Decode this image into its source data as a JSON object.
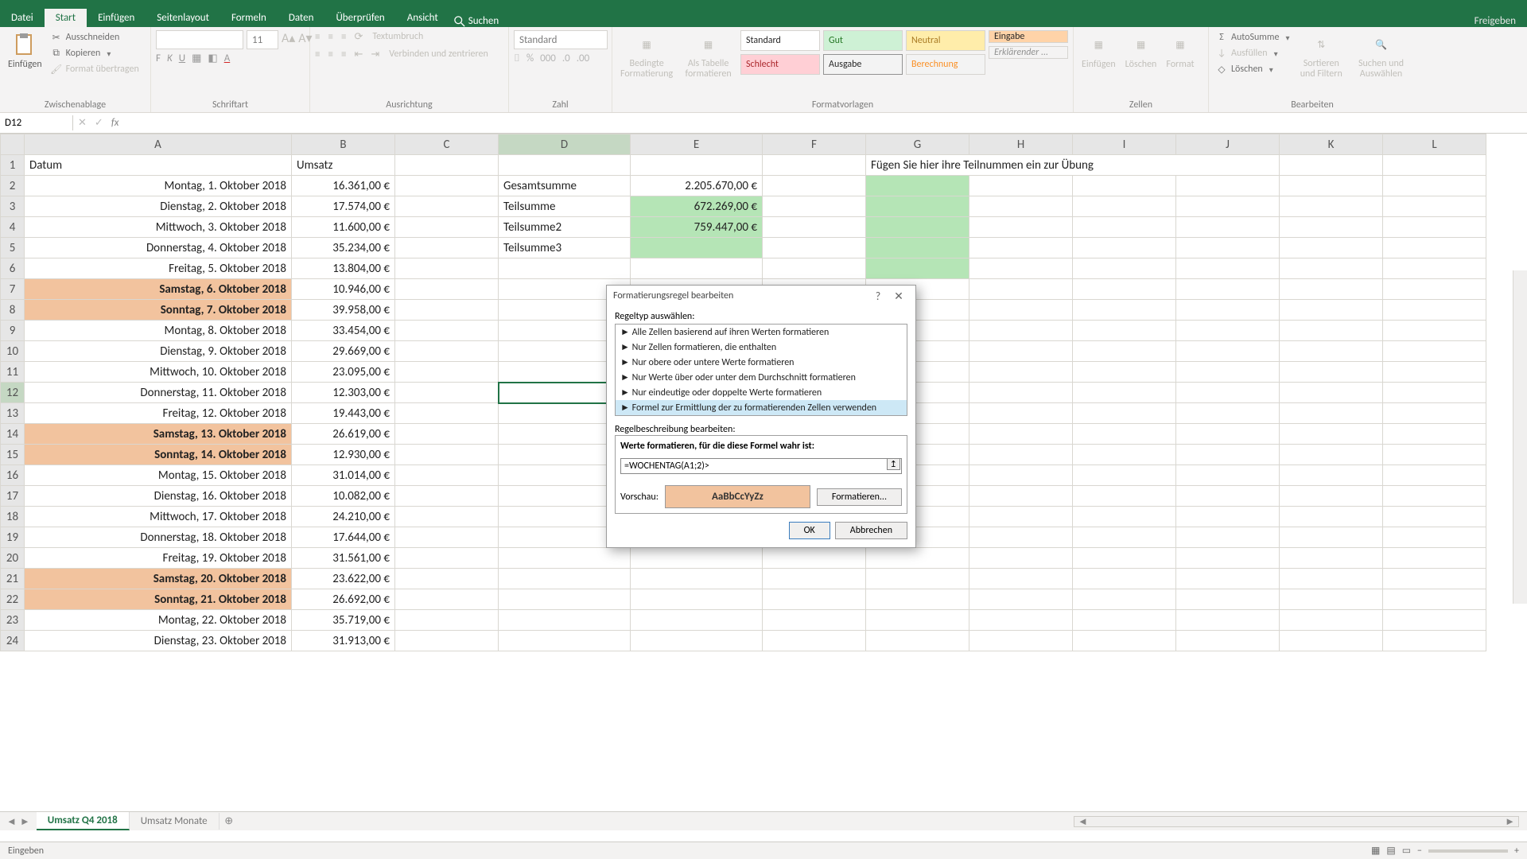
{
  "tabs": {
    "datei": "Datei",
    "start": "Start",
    "einfuegen": "Einfügen",
    "seitenlayout": "Seitenlayout",
    "formeln": "Formeln",
    "daten": "Daten",
    "ueberpruefen": "Überprüfen",
    "ansicht": "Ansicht",
    "suchen": "Suchen"
  },
  "share": "Freigeben",
  "ribbon": {
    "clipboard": {
      "label": "Zwischenablage",
      "paste": "Einfügen",
      "cut": "Ausschneiden",
      "copy": "Kopieren",
      "format": "Format übertragen"
    },
    "font": {
      "label": "Schriftart",
      "font_name": "",
      "size": "11"
    },
    "align": {
      "label": "Ausrichtung",
      "wrap": "Textumbruch",
      "merge": "Verbinden und zentrieren"
    },
    "number": {
      "label": "Zahl",
      "format": "Standard"
    },
    "styles": {
      "label": "Formatvorlagen",
      "cond": "Bedingte Formatierung",
      "table": "Als Tabelle formatieren",
      "s1": "Standard",
      "s2": "Gut",
      "s3": "Neutral",
      "s4": "Schlecht",
      "s5": "Ausgabe",
      "s6": "Berechnung",
      "s7": "Eingabe",
      "s8": "Erklärender ..."
    },
    "cells": {
      "label": "Zellen",
      "insert": "Einfügen",
      "delete": "Löschen",
      "format": "Format"
    },
    "editing": {
      "label": "Bearbeiten",
      "sum": "AutoSumme",
      "fill": "Ausfüllen",
      "clear": "Löschen",
      "sort": "Sortieren und Filtern",
      "find": "Suchen und Auswählen"
    }
  },
  "namebox": "D12",
  "columns": [
    "A",
    "B",
    "C",
    "D",
    "E",
    "F",
    "G",
    "H",
    "I",
    "J",
    "K",
    "L"
  ],
  "header_row": {
    "A": "Datum",
    "B": "Umsatz",
    "G": "Fügen Sie hier ihre Teilnummen ein zur Übung"
  },
  "summary": {
    "d2": "Gesamtsumme",
    "e2": "2.205.670,00 €",
    "d3": "Teilsumme",
    "e3": "672.269,00 €",
    "d4": "Teilsumme2",
    "e4": "759.447,00 €",
    "d5": "Teilsumme3"
  },
  "rows": [
    {
      "r": 2,
      "a": "Montag, 1. Oktober 2018",
      "b": "16.361,00 €"
    },
    {
      "r": 3,
      "a": "Dienstag, 2. Oktober 2018",
      "b": "17.574,00 €"
    },
    {
      "r": 4,
      "a": "Mittwoch, 3. Oktober 2018",
      "b": "11.600,00 €"
    },
    {
      "r": 5,
      "a": "Donnerstag, 4. Oktober 2018",
      "b": "35.234,00 €"
    },
    {
      "r": 6,
      "a": "Freitag, 5. Oktober 2018",
      "b": "13.804,00 €"
    },
    {
      "r": 7,
      "a": "Samstag, 6. Oktober 2018",
      "b": "10.946,00 €",
      "w": true
    },
    {
      "r": 8,
      "a": "Sonntag, 7. Oktober 2018",
      "b": "39.958,00 €",
      "w": true
    },
    {
      "r": 9,
      "a": "Montag, 8. Oktober 2018",
      "b": "33.454,00 €"
    },
    {
      "r": 10,
      "a": "Dienstag, 9. Oktober 2018",
      "b": "29.669,00 €"
    },
    {
      "r": 11,
      "a": "Mittwoch, 10. Oktober 2018",
      "b": "23.095,00 €"
    },
    {
      "r": 12,
      "a": "Donnerstag, 11. Oktober 2018",
      "b": "12.303,00 €"
    },
    {
      "r": 13,
      "a": "Freitag, 12. Oktober 2018",
      "b": "19.443,00 €"
    },
    {
      "r": 14,
      "a": "Samstag, 13. Oktober 2018",
      "b": "26.619,00 €",
      "w": true
    },
    {
      "r": 15,
      "a": "Sonntag, 14. Oktober 2018",
      "b": "12.930,00 €",
      "w": true
    },
    {
      "r": 16,
      "a": "Montag, 15. Oktober 2018",
      "b": "31.014,00 €"
    },
    {
      "r": 17,
      "a": "Dienstag, 16. Oktober 2018",
      "b": "10.082,00 €"
    },
    {
      "r": 18,
      "a": "Mittwoch, 17. Oktober 2018",
      "b": "24.210,00 €"
    },
    {
      "r": 19,
      "a": "Donnerstag, 18. Oktober 2018",
      "b": "17.644,00 €"
    },
    {
      "r": 20,
      "a": "Freitag, 19. Oktober 2018",
      "b": "31.561,00 €"
    },
    {
      "r": 21,
      "a": "Samstag, 20. Oktober 2018",
      "b": "23.622,00 €",
      "w": true
    },
    {
      "r": 22,
      "a": "Sonntag, 21. Oktober 2018",
      "b": "26.692,00 €",
      "w": true
    },
    {
      "r": 23,
      "a": "Montag, 22. Oktober 2018",
      "b": "35.719,00 €"
    },
    {
      "r": 24,
      "a": "Dienstag, 23. Oktober 2018",
      "b": "31.913,00 €"
    }
  ],
  "sheets": {
    "s1": "Umsatz Q4 2018",
    "s2": "Umsatz Monate"
  },
  "status": "Eingeben",
  "dialog": {
    "title": "Formatierungsregel bearbeiten",
    "ruletype_label": "Regeltyp auswählen:",
    "rules": [
      "Alle Zellen basierend auf ihren Werten formatieren",
      "Nur Zellen formatieren, die enthalten",
      "Nur obere oder untere Werte formatieren",
      "Nur Werte über oder unter dem Durchschnitt formatieren",
      "Nur eindeutige oder doppelte Werte formatieren",
      "Formel zur Ermittlung der zu formatierenden Zellen verwenden"
    ],
    "desc_label": "Regelbeschreibung bearbeiten:",
    "formula_label": "Werte formatieren, für die diese Formel wahr ist:",
    "formula": "=WOCHENTAG(A1;2)>",
    "preview_label": "Vorschau:",
    "preview_text": "AaBbCcYyZz",
    "format_btn": "Formatieren...",
    "ok": "OK",
    "cancel": "Abbrechen"
  }
}
